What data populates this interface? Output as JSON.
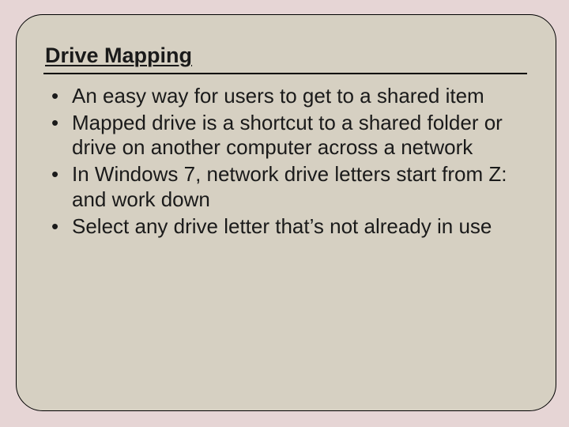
{
  "slide": {
    "title": "Drive Mapping",
    "bullets": [
      "An easy way for users to get to a shared item",
      "Mapped drive is a shortcut to a shared folder or drive on another computer across a network",
      "In Windows 7, network drive letters start from Z: and work down",
      "Select any drive letter that’s not already in use"
    ]
  }
}
